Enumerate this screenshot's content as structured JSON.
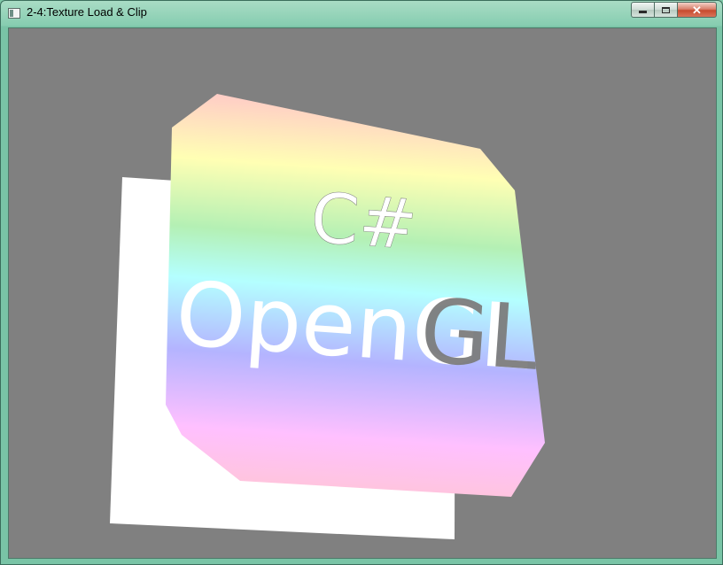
{
  "window": {
    "title": "2-4:Texture Load & Clip",
    "caption_buttons": {
      "minimize_icon": "minimize-icon",
      "maximize_icon": "maximize-icon",
      "close_symbol": "✕"
    }
  },
  "viewport": {
    "background_color": "#808080",
    "back_quad_color": "#ffffff",
    "texture_lines": [
      "C#",
      "OpenGL"
    ],
    "texture_gradient": [
      "#ffc8c8",
      "#ffffb4",
      "#b4f0b4",
      "#b4ffff",
      "#b4b4ff",
      "#ffc0ff",
      "#ffc8c8"
    ]
  }
}
